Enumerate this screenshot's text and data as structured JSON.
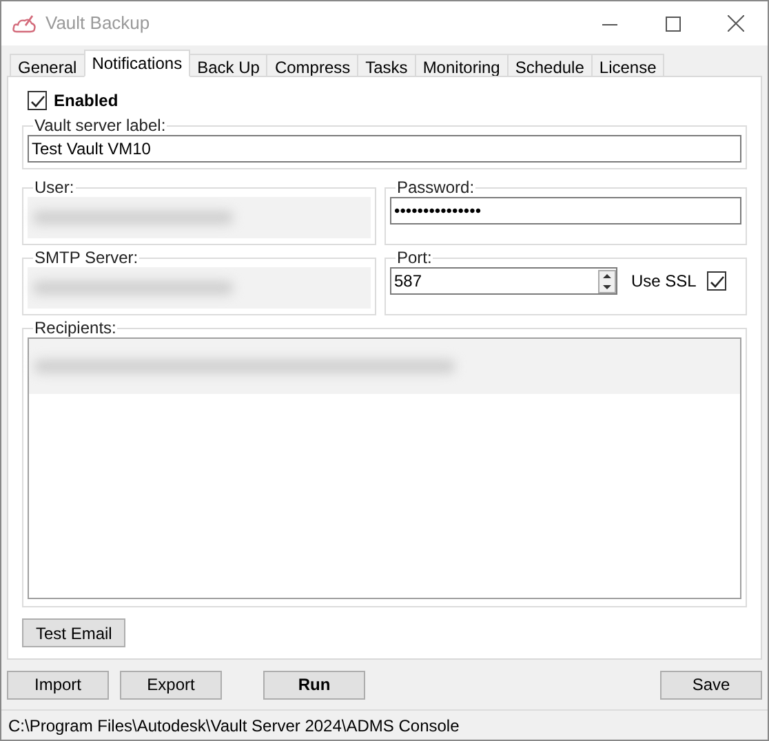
{
  "window": {
    "title": "Vault Backup"
  },
  "tabs": [
    {
      "label": "General",
      "selected": false
    },
    {
      "label": "Notifications",
      "selected": true
    },
    {
      "label": "Back Up",
      "selected": false
    },
    {
      "label": "Compress",
      "selected": false
    },
    {
      "label": "Tasks",
      "selected": false
    },
    {
      "label": "Monitoring",
      "selected": false
    },
    {
      "label": "Schedule",
      "selected": false
    },
    {
      "label": "License",
      "selected": false
    }
  ],
  "enabled": {
    "label": "Enabled",
    "checked": true
  },
  "vault_server_label": {
    "label": "Vault server label:",
    "value": "Test Vault VM10"
  },
  "user": {
    "label": "User:",
    "redacted": true
  },
  "password": {
    "label": "Password:",
    "value": "•••••••••••••••"
  },
  "smtp_server": {
    "label": "SMTP Server:",
    "redacted": true
  },
  "port": {
    "label": "Port:",
    "value": "587"
  },
  "use_ssl": {
    "label": "Use SSL",
    "checked": true
  },
  "recipients": {
    "label": "Recipients:",
    "redacted": true
  },
  "test_email_button": "Test Email",
  "buttons": [
    {
      "label": "Import",
      "bold": false
    },
    {
      "label": "Export",
      "bold": false
    },
    {
      "label": "Run",
      "bold": true
    },
    {
      "label": "Save",
      "bold": false
    }
  ],
  "status_bar": "C:\\Program Files\\Autodesk\\Vault Server 2024\\ADMS Console"
}
